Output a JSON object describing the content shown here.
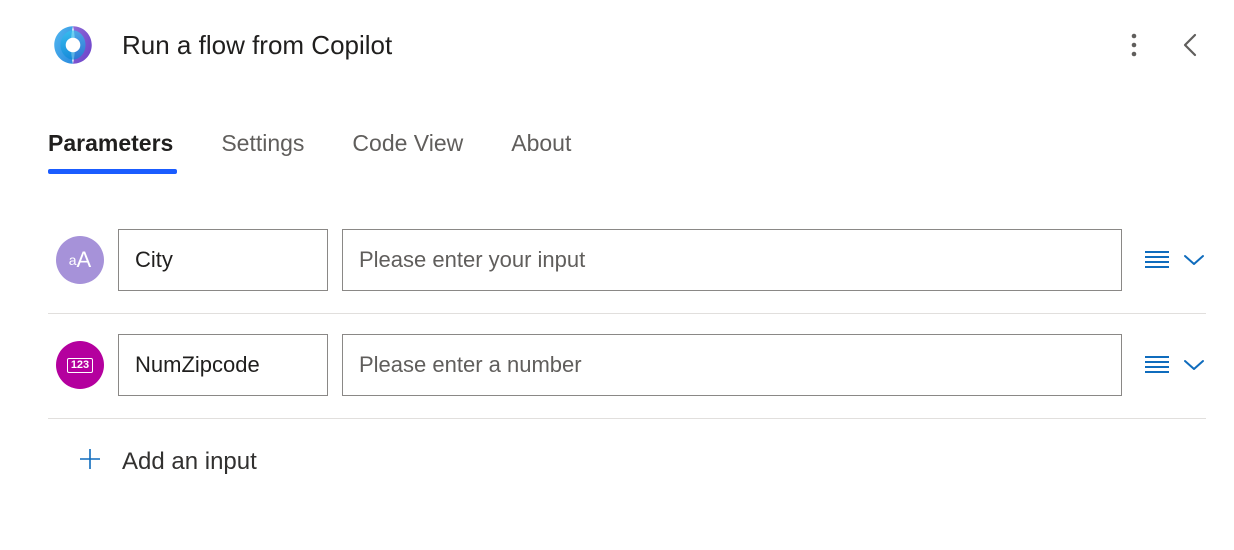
{
  "header": {
    "title": "Run a flow from Copilot"
  },
  "tabs": {
    "items": [
      {
        "label": "Parameters",
        "active": true
      },
      {
        "label": "Settings",
        "active": false
      },
      {
        "label": "Code View",
        "active": false
      },
      {
        "label": "About",
        "active": false
      }
    ]
  },
  "parameters": [
    {
      "type": "text",
      "type_icon": "text-type-icon",
      "name": "City",
      "value": "",
      "placeholder": "Please enter your input"
    },
    {
      "type": "number",
      "type_icon": "number-type-icon",
      "name": "NumZipcode",
      "value": "",
      "placeholder": "Please enter a number"
    }
  ],
  "add_input": {
    "label": "Add an input"
  },
  "colors": {
    "accent_blue": "#0f6cbd",
    "tab_indicator": "#1a5cff",
    "chip_text_bg": "#a692d9",
    "chip_number_bg": "#b4009e"
  },
  "icons": {
    "number_chip_text": "123"
  }
}
